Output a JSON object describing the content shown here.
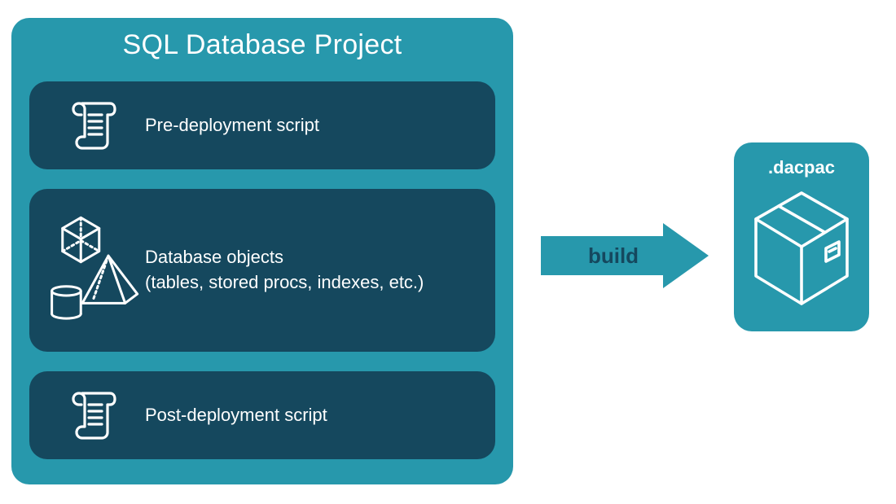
{
  "project": {
    "title": "SQL Database Project",
    "cards": [
      {
        "id": "pre",
        "label": "Pre-deployment script"
      },
      {
        "id": "mid",
        "label": "Database objects\n(tables, stored procs, indexes, etc.)"
      },
      {
        "id": "post",
        "label": "Post-deployment script"
      }
    ]
  },
  "arrow": {
    "label": "build"
  },
  "output": {
    "title": ".dacpac"
  },
  "colors": {
    "teal": "#2798ac",
    "dark": "#15485e",
    "white": "#ffffff"
  }
}
